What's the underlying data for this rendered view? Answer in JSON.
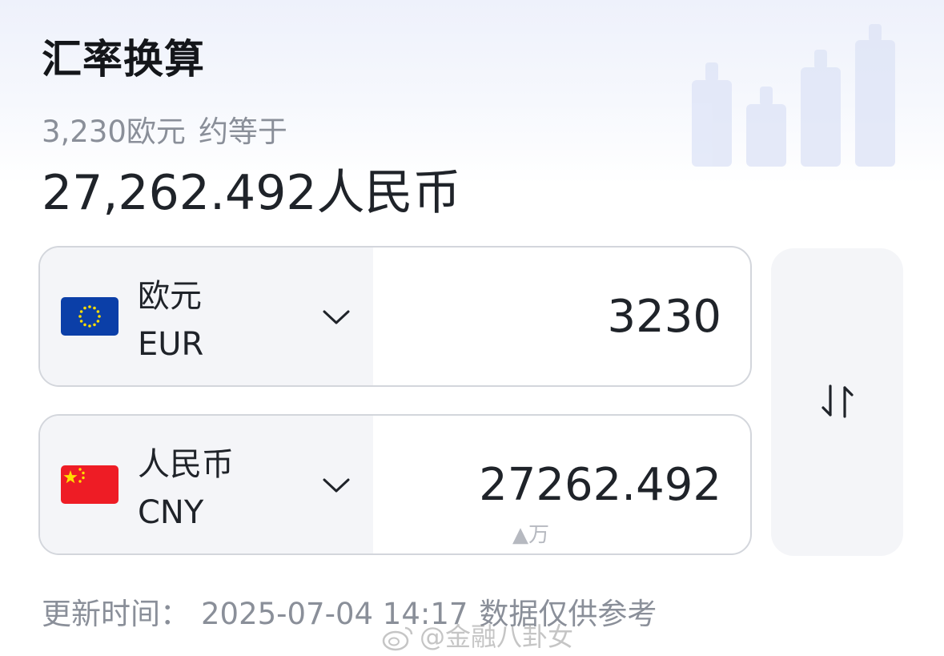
{
  "header": {
    "title": "汇率换算"
  },
  "summary": {
    "from_text": "3,230欧元",
    "approx_text": "约等于",
    "result_text": "27,262.492人民币"
  },
  "from_currency": {
    "name": "欧元",
    "code": "EUR",
    "amount": "3230",
    "flag_icon": "eu-flag-icon"
  },
  "to_currency": {
    "name": "人民币",
    "code": "CNY",
    "amount": "27262.492",
    "unit_hint": "▲万",
    "flag_icon": "china-flag-icon"
  },
  "swap": {
    "icon": "swap-arrows-icon"
  },
  "footer": {
    "update_label": "更新时间：",
    "update_time": "2025-07-04 14:17",
    "disclaimer": "数据仅供参考"
  },
  "watermark": {
    "text": "@金融八卦女"
  },
  "colors": {
    "text_primary": "#1f2329",
    "text_secondary": "#8a8f99",
    "panel_bg": "#f4f5f8",
    "border": "#d3d6dc",
    "eu_blue": "#0b3fa8",
    "china_red": "#ee1c25",
    "star_yellow": "#ffde00"
  }
}
